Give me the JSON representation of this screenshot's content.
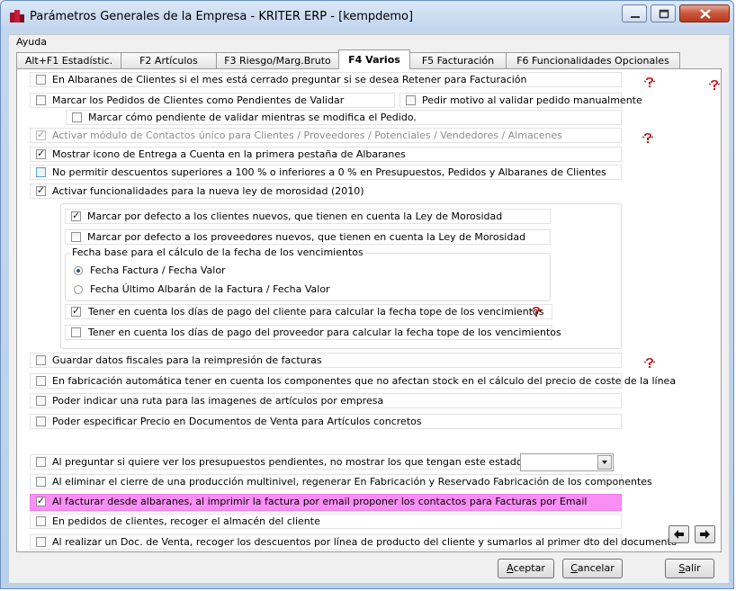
{
  "window": {
    "title": "Parámetros Generales de la Empresa - KRITER ERP - [kempdemo]"
  },
  "menu": {
    "items": [
      "Ayuda"
    ]
  },
  "tabs": [
    {
      "label": "Alt+F1 Estadístic."
    },
    {
      "label": "F2 Artículos"
    },
    {
      "label": "F3 Riesgo/Marg.Bruto"
    },
    {
      "label": "F4 Varios",
      "active": true
    },
    {
      "label": "F5 Facturación"
    },
    {
      "label": "F6 Funcionalidades Opcionales"
    }
  ],
  "options": {
    "albaranes_retener": {
      "label": "En Albaranes de Clientes si el mes está cerrado preguntar si se desea Retener para Facturación",
      "checked": false
    },
    "pedidos_pendientes": {
      "label": "Marcar los Pedidos de Clientes como Pendientes de Validar",
      "checked": false
    },
    "pedir_motivo": {
      "label": "Pedir motivo al validar pedido manualmente",
      "checked": false
    },
    "marcar_pendiente_modifica": {
      "label": "Marcar cómo pendiente de validar mientras se modifica el Pedido.",
      "checked": false
    },
    "modulo_contactos": {
      "label": "Activar módulo de Contactos único para Clientes / Proveedores / Potenciales / Vendedores / Almacenes",
      "checked": true,
      "disabled": true
    },
    "icono_entrega": {
      "label": "Mostrar icono de Entrega a Cuenta en la primera pestaña de Albaranes",
      "checked": true
    },
    "no_permitir_descuentos": {
      "label": "No permitir descuentos superiores a 100 % o inferiores a 0 % en Presupuestos, Pedidos y Albaranes de Clientes",
      "checked": false
    },
    "ley_morosidad": {
      "label": "Activar funcionalidades para la nueva ley de morosidad (2010)",
      "checked": true
    },
    "defecto_clientes": {
      "label": "Marcar por defecto a los clientes nuevos, que tienen en cuenta la Ley de Morosidad",
      "checked": true
    },
    "defecto_proveedores": {
      "label": "Marcar por defecto a los proveedores nuevos, que tienen en cuenta la Ley de Morosidad",
      "checked": false
    },
    "fecha_base_legend": "Fecha base para el cálculo de la fecha de los vencimientos",
    "fecha_factura": {
      "label": "Fecha Factura / Fecha Valor",
      "selected": true
    },
    "fecha_albaran": {
      "label": "Fecha Último Albarán de la Factura / Fecha Valor",
      "selected": false
    },
    "dias_pago_cliente": {
      "label": "Tener en cuenta los días de pago del cliente para calcular la fecha tope de los vencimientos",
      "checked": true
    },
    "dias_pago_proveedor": {
      "label": "Tener en cuenta los días de pago del proveedor para calcular la fecha tope de los vencimientos",
      "checked": false
    },
    "datos_fiscales": {
      "label": "Guardar datos fiscales para la reimpresión de facturas",
      "checked": false
    },
    "fabricacion_componentes": {
      "label": "En fabricación automática tener en cuenta los componentes que no afectan stock en el cálculo del precio de coste de la línea",
      "checked": false
    },
    "ruta_imagenes": {
      "label": "Poder indicar una ruta para las imagenes de artículos por empresa",
      "checked": false
    },
    "precio_documentos": {
      "label": "Poder especificar Precio en Documentos de Venta para Artículos concretos",
      "checked": false
    },
    "presupuestos_pendientes": {
      "label": "Al preguntar si quiere ver los presupuestos pendientes, no mostrar los que tengan este estado",
      "checked": false
    },
    "cierre_produccion": {
      "label": "Al eliminar el cierre de una producción multinivel, regenerar En Fabricación y Reservado Fabricación de los componentes",
      "checked": false
    },
    "factura_email": {
      "label": "Al facturar desde albaranes, al imprimir la factura por email proponer los contactos para Facturas por Email",
      "checked": true
    },
    "almacen_cliente": {
      "label": "En pedidos de clientes, recoger el almacén del cliente",
      "checked": false
    },
    "descuentos_linea": {
      "label": "Al realizar un Doc. de Venta, recoger los descuentos por línea de producto del cliente y sumarlos al primer dto del documento",
      "checked": false
    }
  },
  "estado_select": {
    "value": ""
  },
  "buttons": {
    "aceptar": {
      "first": "A",
      "rest": "ceptar"
    },
    "cancelar": {
      "first": "C",
      "rest": "ancelar"
    },
    "salir": {
      "first": "S",
      "rest": "alir"
    }
  },
  "colors": {
    "highlight": "#f98ff5",
    "help_icon": "#c0171c"
  },
  "icons": [
    "app-icon",
    "help-icon",
    "arrow-left-icon",
    "arrow-right-icon",
    "chevron-down-icon"
  ]
}
